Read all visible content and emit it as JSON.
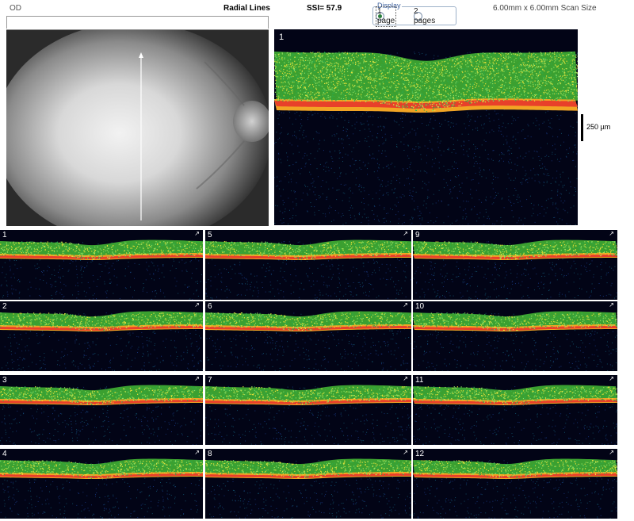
{
  "header": {
    "eye": "OD",
    "scan_name": "Radial Lines",
    "ssi": "SSI= 57.9",
    "scan_size": "6.00mm x 6.00mm Scan Size"
  },
  "display": {
    "label": "Display",
    "options": [
      {
        "label": "1 page",
        "selected": true
      },
      {
        "label": "2 pages",
        "selected": false
      }
    ]
  },
  "main_scan": {
    "number": "1"
  },
  "scale_label": "250 µm",
  "thumbnails": [
    "1",
    "5",
    "9",
    "2",
    "6",
    "10",
    "3",
    "7",
    "11",
    "4",
    "8",
    "12"
  ],
  "colors": {
    "retina_green": "#4fd43a",
    "rpe_red": "#e8402a",
    "rpe_orange": "#f2a424",
    "background": "#020416"
  }
}
